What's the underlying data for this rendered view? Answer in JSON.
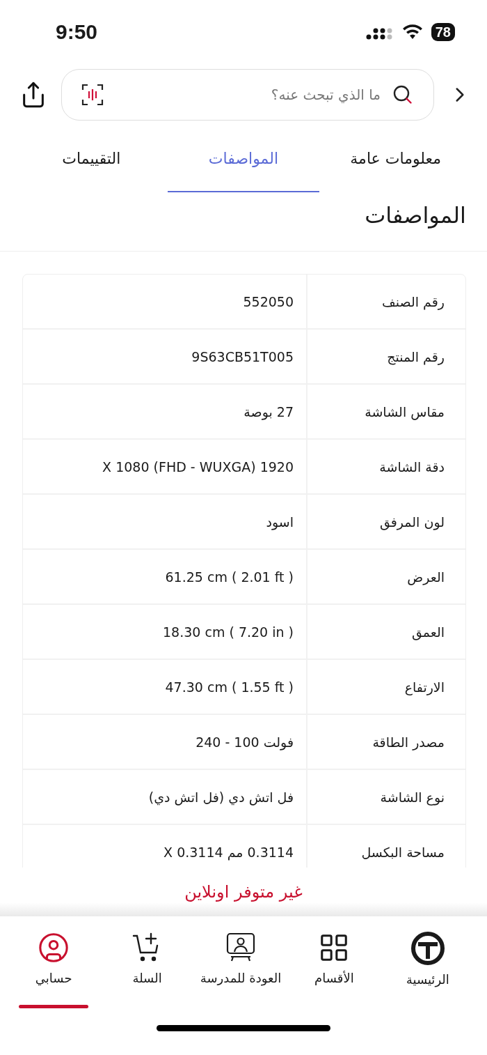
{
  "status_bar": {
    "time": "9:50",
    "battery": "78"
  },
  "search": {
    "placeholder": "ما الذي تبحث عنه؟"
  },
  "tabs": [
    {
      "label": "معلومات عامة",
      "selected": false
    },
    {
      "label": "المواصفات",
      "selected": true
    },
    {
      "label": "التقييمات",
      "selected": false
    }
  ],
  "section_title": "المواصفات",
  "specs": [
    {
      "label": "رقم الصنف",
      "value": "552050"
    },
    {
      "label": "رقم المنتج",
      "value": "9S63CB51T005"
    },
    {
      "label": "مقاس الشاشة",
      "value": "27 بوصة"
    },
    {
      "label": "دقة الشاشة",
      "value": "X 1080 (FHD - WUXGA) 1920"
    },
    {
      "label": "لون المرفق",
      "value": "اسود"
    },
    {
      "label": "العرض",
      "value": "61.25 cm ( 2.01 ft )"
    },
    {
      "label": "العمق",
      "value": "18.30 cm ( 7.20 in )"
    },
    {
      "label": "الارتفاع",
      "value": "47.30 cm ( 1.55 ft )"
    },
    {
      "label": "مصدر الطاقة",
      "value": "فولت 100 - 240"
    },
    {
      "label": "نوع الشاشة",
      "value": "فل اتش دي (فل اتش دي)"
    },
    {
      "label": "مساحة البكسل",
      "value": "0.3114 مم 0.3114 X"
    }
  ],
  "availability": "غير متوفر اونلاين",
  "bottom_nav": [
    {
      "kind": "home",
      "label": "الرئيسية",
      "selected": false
    },
    {
      "kind": "categories",
      "label": "الأقسام",
      "selected": false
    },
    {
      "kind": "school",
      "label": "العودة للمدرسة",
      "selected": false
    },
    {
      "kind": "cart",
      "label": "السلة",
      "selected": false
    },
    {
      "kind": "account",
      "label": "حسابي",
      "selected": true
    }
  ]
}
